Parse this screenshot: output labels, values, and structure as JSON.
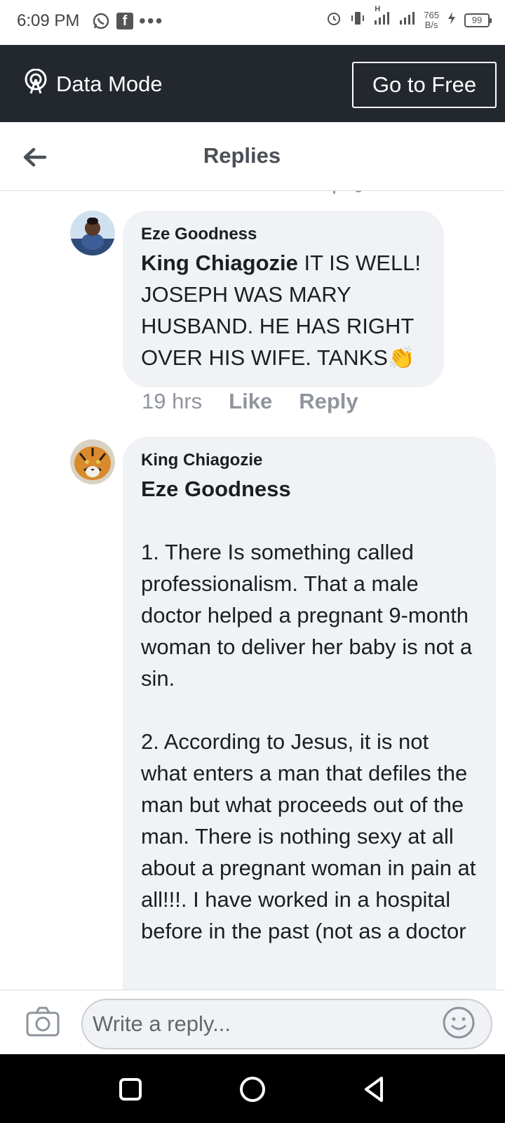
{
  "status_bar": {
    "time": "6:09 PM",
    "speed_top": "765",
    "speed_bottom": "B/s",
    "battery": "99",
    "net_label": "H"
  },
  "data_bar": {
    "mode_label": "Data Mode",
    "go_free_label": "Go to Free"
  },
  "header": {
    "title": "Replies"
  },
  "comments": [
    {
      "author": "Eze Goodness",
      "mention": "King Chiagozie",
      "text": " IT IS WELL! JOSEPH WAS MARY HUSBAND. HE HAS RIGHT OVER HIS WIFE. TANKS",
      "emoji": "👏",
      "time": "19 hrs",
      "like_label": "Like",
      "reply_label": "Reply"
    },
    {
      "author": "King Chiagozie",
      "mention": "Eze Goodness",
      "paragraph1": "1. There Is something called professionalism. That a male doctor helped a pregnant 9-month woman to deliver her baby is not a sin.",
      "paragraph2": "2. According to Jesus, it is not what enters a man that defiles the man but what proceeds out of the man. There is nothing sexy at all about a pregnant woman in pain at all!!!. I have worked in a hospital before in the past (not as a doctor"
    }
  ],
  "composer": {
    "placeholder": "Write a reply..."
  },
  "colors": {
    "data_bar_bg": "#23272e",
    "bubble_bg": "#f0f2f5",
    "meta_gray": "#90949c",
    "nav_bg": "#000000"
  }
}
